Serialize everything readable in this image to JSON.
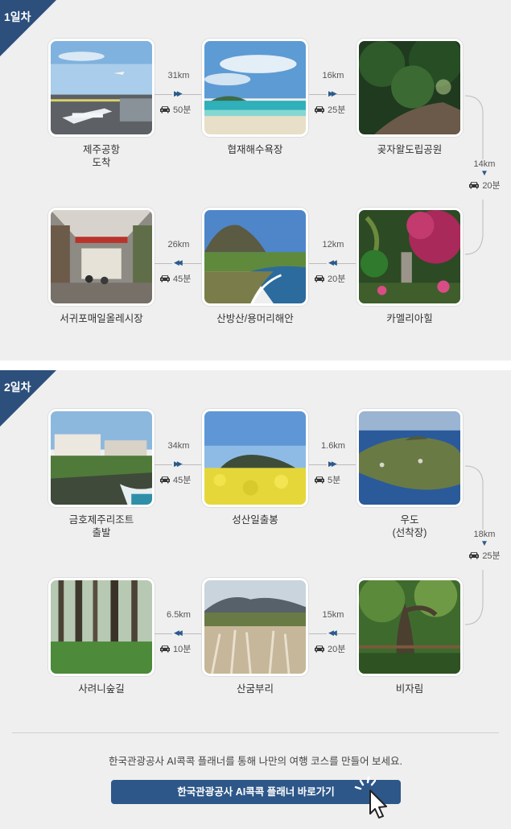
{
  "day1": {
    "tag": "1일차",
    "spots": [
      {
        "name": "제주공항\n도착",
        "scene": "airport"
      },
      {
        "name": "협재해수욕장",
        "scene": "beach"
      },
      {
        "name": "곶자왈도립공원",
        "scene": "forest"
      },
      {
        "name": "서귀포매일올레시장",
        "scene": "market"
      },
      {
        "name": "산방산/용머리해안",
        "scene": "mountain-coast"
      },
      {
        "name": "카멜리아힐",
        "scene": "garden"
      }
    ],
    "legs": [
      {
        "km": "31km",
        "time": "50분"
      },
      {
        "km": "16km",
        "time": "25분"
      },
      {
        "km": "14km",
        "time": "20분"
      },
      {
        "km": "12km",
        "time": "20분"
      },
      {
        "km": "26km",
        "time": "45분"
      }
    ]
  },
  "day2": {
    "tag": "2일차",
    "spots": [
      {
        "name": "금호제주리조트\n출발",
        "scene": "resort"
      },
      {
        "name": "성산일출봉",
        "scene": "canola"
      },
      {
        "name": "우도\n(선착장)",
        "scene": "island"
      },
      {
        "name": "사려니숲길",
        "scene": "cedar"
      },
      {
        "name": "산굼부리",
        "scene": "silvergrass"
      },
      {
        "name": "비자림",
        "scene": "nutmeg"
      }
    ],
    "legs": [
      {
        "km": "34km",
        "time": "45분"
      },
      {
        "km": "1.6km",
        "time": "5분"
      },
      {
        "km": "18km",
        "time": "25분"
      },
      {
        "km": "15km",
        "time": "20분"
      },
      {
        "km": "6.5km",
        "time": "10분"
      }
    ]
  },
  "footer": {
    "description": "한국관광공사 AI콕콕 플래너를 통해 나만의 여행 코스를 만들어 보세요.",
    "cta_label": "한국관광공사 AI콕콕 플래너 바로가기"
  },
  "colors": {
    "accent": "#2d5788",
    "tag": "#2c4f7c",
    "arrow": "#2c5a8c"
  },
  "icons": {
    "car": "car-icon",
    "arrow_right": "double-arrow-right-icon",
    "arrow_left": "double-arrow-left-icon",
    "arrow_down": "arrow-down-icon",
    "cursor": "click-cursor-icon"
  }
}
